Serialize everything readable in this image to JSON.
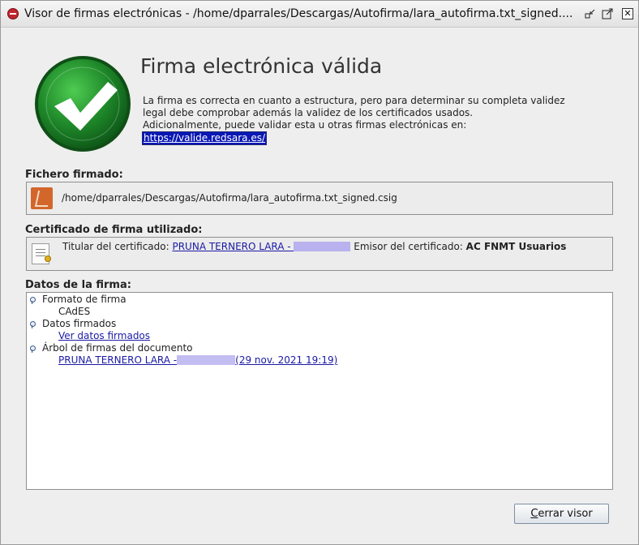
{
  "window": {
    "title": "Visor de firmas electrónicas - /home/dparrales/Descargas/Autofirma/lara_autofirma.txt_signed....",
    "icon": "autofirma-icon",
    "controls": {
      "iconify": "▫",
      "maximize": "⤢",
      "close": "✕"
    }
  },
  "status": {
    "heading": "Firma electrónica válida",
    "icon": "green-check-icon",
    "description_line1": "La firma es correcta en cuanto a estructura, pero para determinar su completa validez",
    "description_line2": "legal debe comprobar además la validez de los certificados usados.",
    "description_line3": "Adicionalmente, puede validar esta u otras firmas electrónicas en:",
    "validation_link": "https://valide.redsara.es/"
  },
  "signed_file": {
    "label": "Fichero firmado:",
    "path": "/home/dparrales/Descargas/Autofirma/lara_autofirma.txt_signed.csig",
    "icon": "signed-file-icon"
  },
  "certificate": {
    "label": "Certificado de firma utilizado:",
    "holder_label": "Titular del certificado:",
    "holder_value": "PRUNA TERNERO LARA -",
    "issuer_label": "Emisor del certificado:",
    "issuer_value": "AC FNMT Usuarios",
    "icon": "certificate-icon"
  },
  "signature_data": {
    "label": "Datos de la firma:",
    "items": [
      {
        "title": "Formato de firma",
        "value": "CAdES",
        "is_link": false
      },
      {
        "title": "Datos firmados",
        "value": "Ver datos firmados",
        "is_link": true
      },
      {
        "title": "Árbol de firmas del documento",
        "value_prefix": "PRUNA TERNERO LARA -",
        "value_suffix": "(29 nov. 2021 19:19)",
        "is_link": true
      }
    ]
  },
  "actions": {
    "close_label_mnemonic": "C",
    "close_label_rest": "errar visor"
  },
  "colors": {
    "check_green": "#1f8a2a",
    "link_blue": "#1a1aa6",
    "selected_link_bg": "#0a18b5",
    "redaction": "#b9b2ee"
  }
}
